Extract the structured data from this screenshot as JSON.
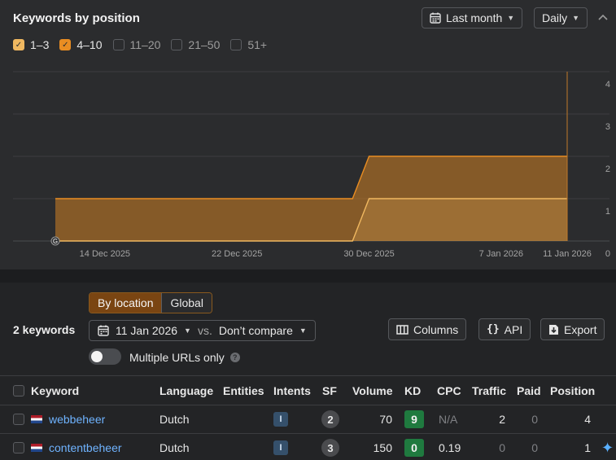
{
  "header": {
    "title": "Keywords by position",
    "date_range": "Last month",
    "granularity": "Daily",
    "calendar_icon": "calendar-icon",
    "collapse_icon": "chevron-up-icon"
  },
  "filters": [
    {
      "label": "1–3",
      "checked": true,
      "color": "#f0b860"
    },
    {
      "label": "4–10",
      "checked": true,
      "color": "#e98d22"
    },
    {
      "label": "11–20",
      "checked": false
    },
    {
      "label": "21–50",
      "checked": false
    },
    {
      "label": "51+",
      "checked": false
    }
  ],
  "chart_data": {
    "type": "area",
    "x_labels": [
      "14 Dec 2025",
      "22 Dec 2025",
      "30 Dec 2025",
      "7 Jan 2026",
      "11 Jan 2026"
    ],
    "y_ticks": [
      "0",
      "1",
      "2",
      "3",
      "4"
    ],
    "ylim": [
      0,
      4
    ],
    "series": [
      {
        "name": "1–3",
        "color": "#f0b860",
        "points": [
          [
            "11 Dec 2025",
            0
          ],
          [
            "29 Dec 2025",
            0
          ],
          [
            "30 Dec 2025",
            1
          ],
          [
            "11 Jan 2026",
            1
          ]
        ]
      },
      {
        "name": "4–10",
        "color": "#e98d22",
        "points": [
          [
            "11 Dec 2025",
            1
          ],
          [
            "29 Dec 2025",
            1
          ],
          [
            "30 Dec 2025",
            2
          ],
          [
            "11 Jan 2026",
            2
          ]
        ]
      }
    ],
    "grid": true,
    "y_axis_side": "right"
  },
  "toolbar": {
    "by_location": "By location",
    "global": "Global",
    "keyword_count": "2 keywords",
    "date": "11 Jan 2026",
    "vs": "vs.",
    "compare": "Don’t compare",
    "columns": "Columns",
    "api": "API",
    "export": "Export",
    "multiple_urls": "Multiple URLs only",
    "help": "?"
  },
  "table": {
    "headers": [
      "Keyword",
      "Language",
      "Entities",
      "Intents",
      "SF",
      "Volume",
      "KD",
      "CPC",
      "Traffic",
      "Paid",
      "Position"
    ],
    "rows": [
      {
        "keyword": "webbeheer",
        "language": "Dutch",
        "intent": "I",
        "sf": "2",
        "volume": "70",
        "kd": "9",
        "kd_color": "#1f7a3f",
        "cpc": "N/A",
        "traffic": "2",
        "paid": "0",
        "position": "4"
      },
      {
        "keyword": "contentbeheer",
        "language": "Dutch",
        "intent": "I",
        "sf": "3",
        "volume": "150",
        "kd": "0",
        "kd_color": "#1f7a3f",
        "cpc": "0.19",
        "traffic": "0",
        "paid": "0",
        "position": "1"
      }
    ]
  }
}
